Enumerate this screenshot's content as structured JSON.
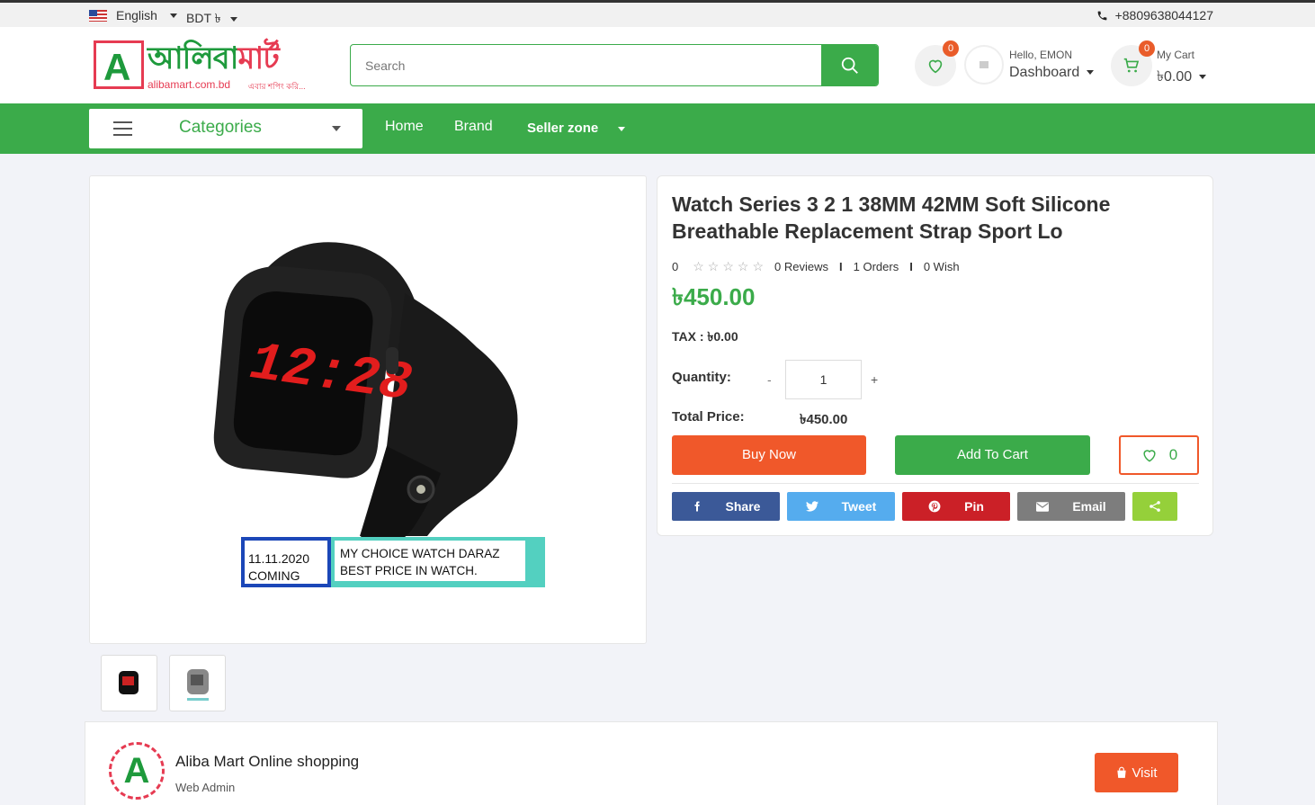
{
  "topbar": {
    "language": "English",
    "currency": "BDT ৳",
    "phone": "+8809638044127"
  },
  "header": {
    "logo_bn_1": "আলিবা",
    "logo_bn_2": "মার্ট",
    "logo_letter": "A",
    "logo_url": "alibamart.com.bd",
    "logo_tagline": "এবার শপিং করি...",
    "search_placeholder": "Search",
    "wishlist_count": "0",
    "greeting": "Hello, EMON",
    "dashboard_label": "Dashboard",
    "cart_count": "0",
    "cart_label": "My Cart",
    "cart_amount": "৳0.00"
  },
  "nav": {
    "categories_label": "Categories",
    "links": [
      "Home",
      "Brand",
      "Seller zone"
    ]
  },
  "product": {
    "title": "Watch Series 3 2 1 38MM 42MM Soft Silicone Breathable Replacement Strap Sport Lo",
    "rating": "0",
    "reviews": "0 Reviews",
    "orders": "1 Orders",
    "wish": "0 Wish",
    "price": "৳450.00",
    "tax_label": "TAX :",
    "tax_value": "৳0.00",
    "quantity_label": "Quantity:",
    "quantity_minus": "-",
    "quantity_value": "1",
    "quantity_plus": "+",
    "total_label": "Total Price:",
    "total_value": "৳450.00",
    "buy_now": "Buy Now",
    "add_to_cart": "Add To Cart",
    "wishlist_count": "0",
    "image_caption_date": "11.11.2020",
    "image_caption_coming": "COMING",
    "image_caption_line1": "MY CHOICE  WATCH DARAZ",
    "image_caption_line2": "BEST PRICE IN  WATCH.",
    "watch_display": "12:28"
  },
  "share": [
    {
      "label": "Share",
      "color": "#3b5998",
      "icon": "facebook-icon"
    },
    {
      "label": "Tweet",
      "color": "#55acee",
      "icon": "twitter-icon"
    },
    {
      "label": "Pin",
      "color": "#cb2027",
      "icon": "pinterest-icon"
    },
    {
      "label": "Email",
      "color": "#7d7d7d",
      "icon": "email-icon"
    },
    {
      "label": "",
      "color": "#95d03a",
      "icon": "share-icon"
    }
  ],
  "seller": {
    "name": "Aliba Mart Online shopping",
    "role": "Web Admin",
    "visit_label": "Visit",
    "logo_letter": "A"
  },
  "colors": {
    "brand_green": "#3bab4a",
    "accent_orange": "#f0582a",
    "logo_red": "#e63b52"
  }
}
